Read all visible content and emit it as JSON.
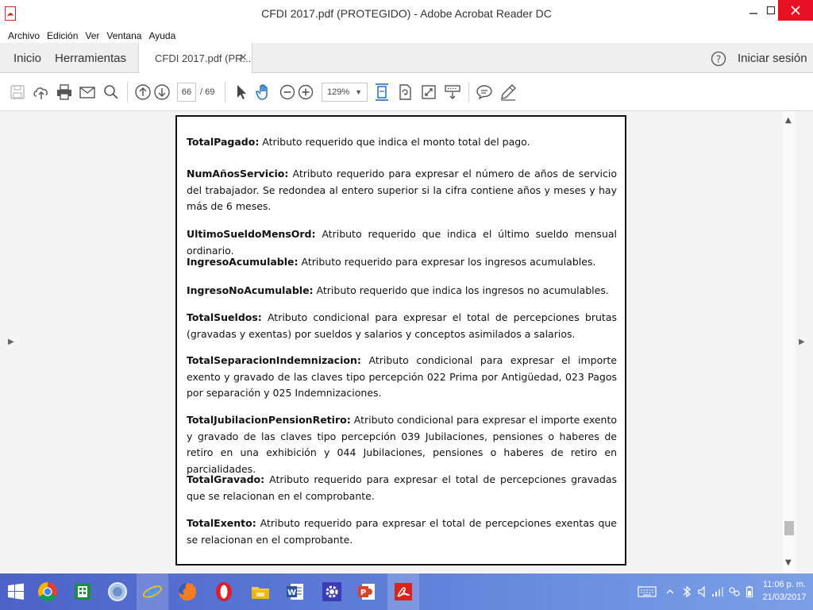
{
  "window": {
    "title": "CFDI 2017.pdf (PROTEGIDO) - Adobe Acrobat Reader DC"
  },
  "menu": [
    "Archivo",
    "Edición",
    "Ver",
    "Ventana",
    "Ayuda"
  ],
  "tabs": {
    "home": "Inicio",
    "tools": "Herramientas",
    "document": "CFDI 2017.pdf (PR...",
    "close": "×",
    "signin": "Iniciar sesión"
  },
  "toolbar": {
    "page_current": "66",
    "page_total": "/ 69",
    "zoom": "129%"
  },
  "document": {
    "paragraphs": [
      {
        "term": "TotalPagado:",
        "text": " Atributo requerido que indica el monto total del pago."
      },
      {
        "term": "NumAñosServicio:",
        "text": " Atributo requerido para expresar el número de años de servicio del trabajador. Se redondea al entero superior si la cifra contiene años y meses y hay más de 6 meses."
      },
      {
        "term": "UltimoSueldoMensOrd:",
        "text": " Atributo requerido que indica el último sueldo mensual ordinario."
      },
      {
        "term": "IngresoAcumulable:",
        "text": " Atributo requerido para expresar los ingresos acumulables."
      },
      {
        "term": "IngresoNoAcumulable:",
        "text": " Atributo requerido que indica los ingresos no acumulables."
      },
      {
        "term": "TotalSueldos:",
        "text": " Atributo condicional para expresar el total de percepciones brutas (gravadas y exentas) por sueldos y salarios y conceptos asimilados a salarios."
      },
      {
        "term": "TotalSeparacionIndemnizacion:",
        "text": " Atributo condicional para expresar el importe exento y gravado de las claves tipo percepción 022 Prima por Antigüedad, 023 Pagos por separación y 025 Indemnizaciones."
      },
      {
        "term": "TotalJubilacionPensionRetiro:",
        "text": " Atributo condicional para expresar el importe exento y gravado de las claves tipo percepción 039 Jubilaciones, pensiones o haberes de retiro en una exhibición y 044 Jubilaciones, pensiones o haberes de retiro en parcialidades."
      },
      {
        "term": "TotalGravado:",
        "text": " Atributo requerido para expresar el total de percepciones gravadas que se relacionan en el comprobante."
      },
      {
        "term": "TotalExento:",
        "text": " Atributo requerido para expresar el total de percepciones exentas que se relacionan en el comprobante."
      }
    ]
  },
  "taskbar": {
    "apps": [
      "start-icon",
      "chrome-icon",
      "excel-store-icon",
      "browser-icon",
      "internet-explorer-icon",
      "firefox-icon",
      "opera-icon",
      "file-explorer-icon",
      "word-icon",
      "settings-icon",
      "powerpoint-icon",
      "acrobat-icon"
    ],
    "clock_time": "11:06 p. m.",
    "clock_date": "21/03/2017"
  },
  "colors": {
    "close_button": "#e81123",
    "acrobat_red": "#d9241c",
    "toolbar_blue": "#1f6fbf"
  }
}
